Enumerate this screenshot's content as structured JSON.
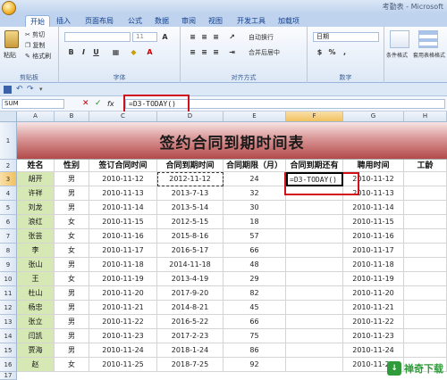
{
  "window": {
    "title": "考勤表 - Microsoft"
  },
  "ribbon": {
    "tabs": [
      "开始",
      "插入",
      "页面布局",
      "公式",
      "数据",
      "审阅",
      "视图",
      "开发工具",
      "加载项"
    ],
    "clipboard": {
      "paste": "粘贴",
      "cut": "剪切",
      "copy": "复制",
      "format_painter": "格式刷",
      "label": "剪贴板"
    },
    "font": {
      "size": "11",
      "label": "字体"
    },
    "alignment": {
      "wrap": "自动换行",
      "merge": "合并后居中",
      "label": "对齐方式"
    },
    "number": {
      "format": "日期",
      "label": "数字"
    },
    "styles": {
      "conditional": "条件格式",
      "table": "套用表格格式"
    }
  },
  "formula_bar": {
    "name_box": "SUM",
    "cancel": "✕",
    "enter": "✓",
    "fx": "fx",
    "formula": "=D3-TODAY()"
  },
  "grid": {
    "columns": [
      "A",
      "B",
      "C",
      "D",
      "E",
      "F",
      "G",
      "H"
    ],
    "rows": [
      "1",
      "2",
      "3",
      "4",
      "5",
      "6",
      "7",
      "8",
      "9",
      "10",
      "11",
      "12",
      "13",
      "14",
      "15",
      "16",
      "17"
    ],
    "banner_title": "签约合同到期时间表",
    "headers": [
      "姓名",
      "性别",
      "签订合同时间",
      "合同到期时间",
      "合同期限（月）",
      "合同到期还有",
      "聘用时间",
      "工龄"
    ],
    "active_cell_text": "=D3-TODAY()",
    "data": [
      {
        "name": "胡开",
        "sex": "男",
        "sign": "2010-11-12",
        "expire": "2012-11-12",
        "months": "24",
        "hire": "2010-11-12"
      },
      {
        "name": "许祥",
        "sex": "男",
        "sign": "2010-11-13",
        "expire": "2013-7-13",
        "months": "32",
        "hire": "2010-11-13"
      },
      {
        "name": "刘龙",
        "sex": "男",
        "sign": "2010-11-14",
        "expire": "2013-5-14",
        "months": "30",
        "hire": "2010-11-14"
      },
      {
        "name": "浪红",
        "sex": "女",
        "sign": "2010-11-15",
        "expire": "2012-5-15",
        "months": "18",
        "hire": "2010-11-15"
      },
      {
        "name": "张芸",
        "sex": "女",
        "sign": "2010-11-16",
        "expire": "2015-8-16",
        "months": "57",
        "hire": "2010-11-16"
      },
      {
        "name": "李",
        "sex": "女",
        "sign": "2010-11-17",
        "expire": "2016-5-17",
        "months": "66",
        "hire": "2010-11-17"
      },
      {
        "name": "张山",
        "sex": "男",
        "sign": "2010-11-18",
        "expire": "2014-11-18",
        "months": "48",
        "hire": "2010-11-18"
      },
      {
        "name": "王",
        "sex": "女",
        "sign": "2010-11-19",
        "expire": "2013-4-19",
        "months": "29",
        "hire": "2010-11-19"
      },
      {
        "name": "杜山",
        "sex": "男",
        "sign": "2010-11-20",
        "expire": "2017-9-20",
        "months": "82",
        "hire": "2010-11-20"
      },
      {
        "name": "杨忠",
        "sex": "男",
        "sign": "2010-11-21",
        "expire": "2014-8-21",
        "months": "45",
        "hire": "2010-11-21"
      },
      {
        "name": "张立",
        "sex": "男",
        "sign": "2010-11-22",
        "expire": "2016-5-22",
        "months": "66",
        "hire": "2010-11-22"
      },
      {
        "name": "闫凯",
        "sex": "男",
        "sign": "2010-11-23",
        "expire": "2017-2-23",
        "months": "75",
        "hire": "2010-11-23"
      },
      {
        "name": "贾海",
        "sex": "男",
        "sign": "2010-11-24",
        "expire": "2018-1-24",
        "months": "86",
        "hire": "2010-11-24"
      },
      {
        "name": "赵",
        "sex": "女",
        "sign": "2010-11-25",
        "expire": "2018-7-25",
        "months": "92",
        "hire": "2010-11-25"
      }
    ]
  },
  "watermark": {
    "badge": "↓",
    "text": "禅奇下载"
  },
  "colors": {
    "accent": "#d0101c",
    "name_fill": "#d6e8b4",
    "banner_dark": "#b34a4a"
  }
}
